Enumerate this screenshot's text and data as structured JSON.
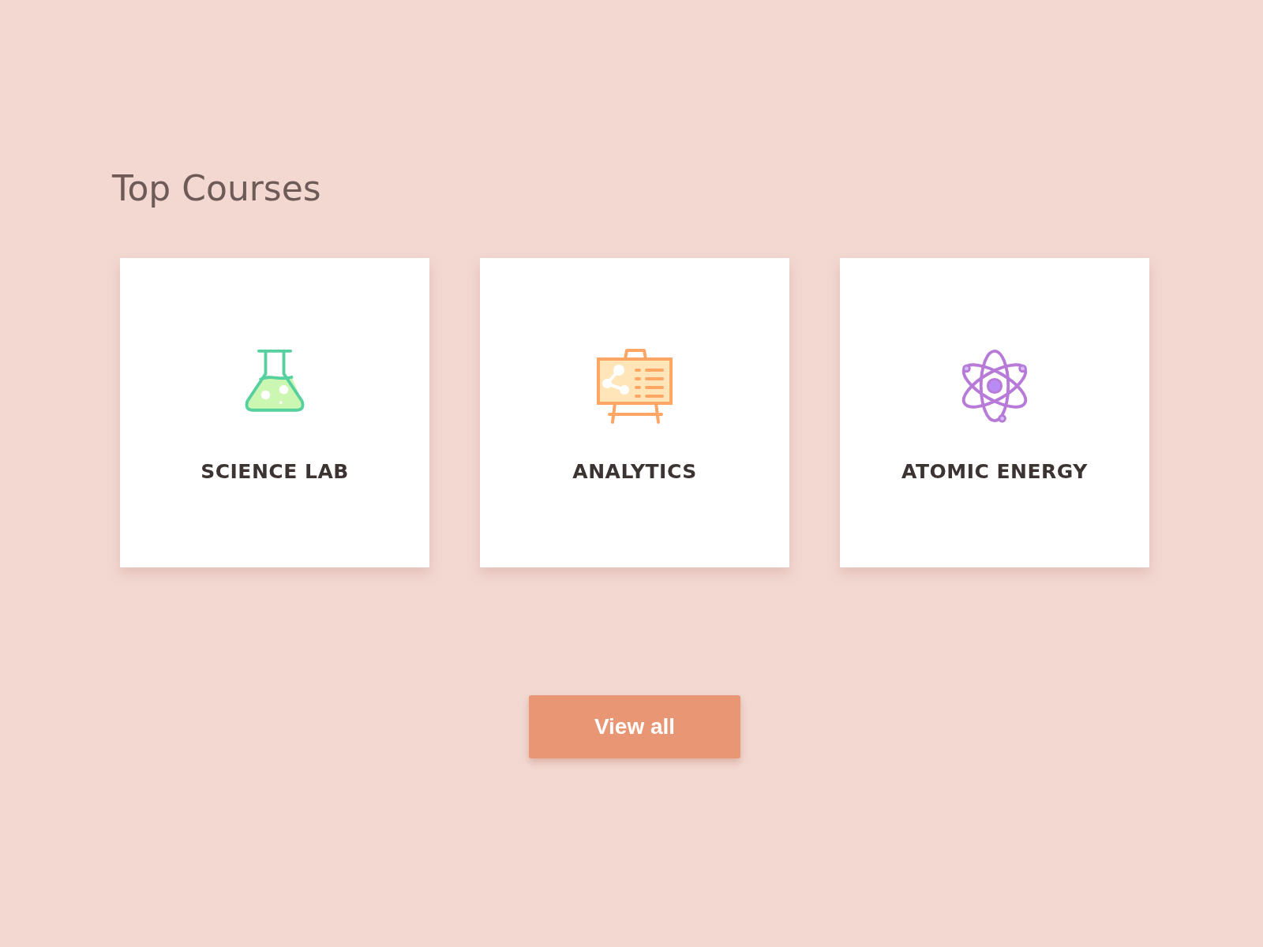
{
  "heading": "Top Courses",
  "courses": [
    {
      "title": "SCIENCE LAB",
      "kind": "flask"
    },
    {
      "title": "ANALYTICS",
      "kind": "easel"
    },
    {
      "title": "ATOMIC ENERGY",
      "kind": "atom"
    }
  ],
  "button": "View all"
}
